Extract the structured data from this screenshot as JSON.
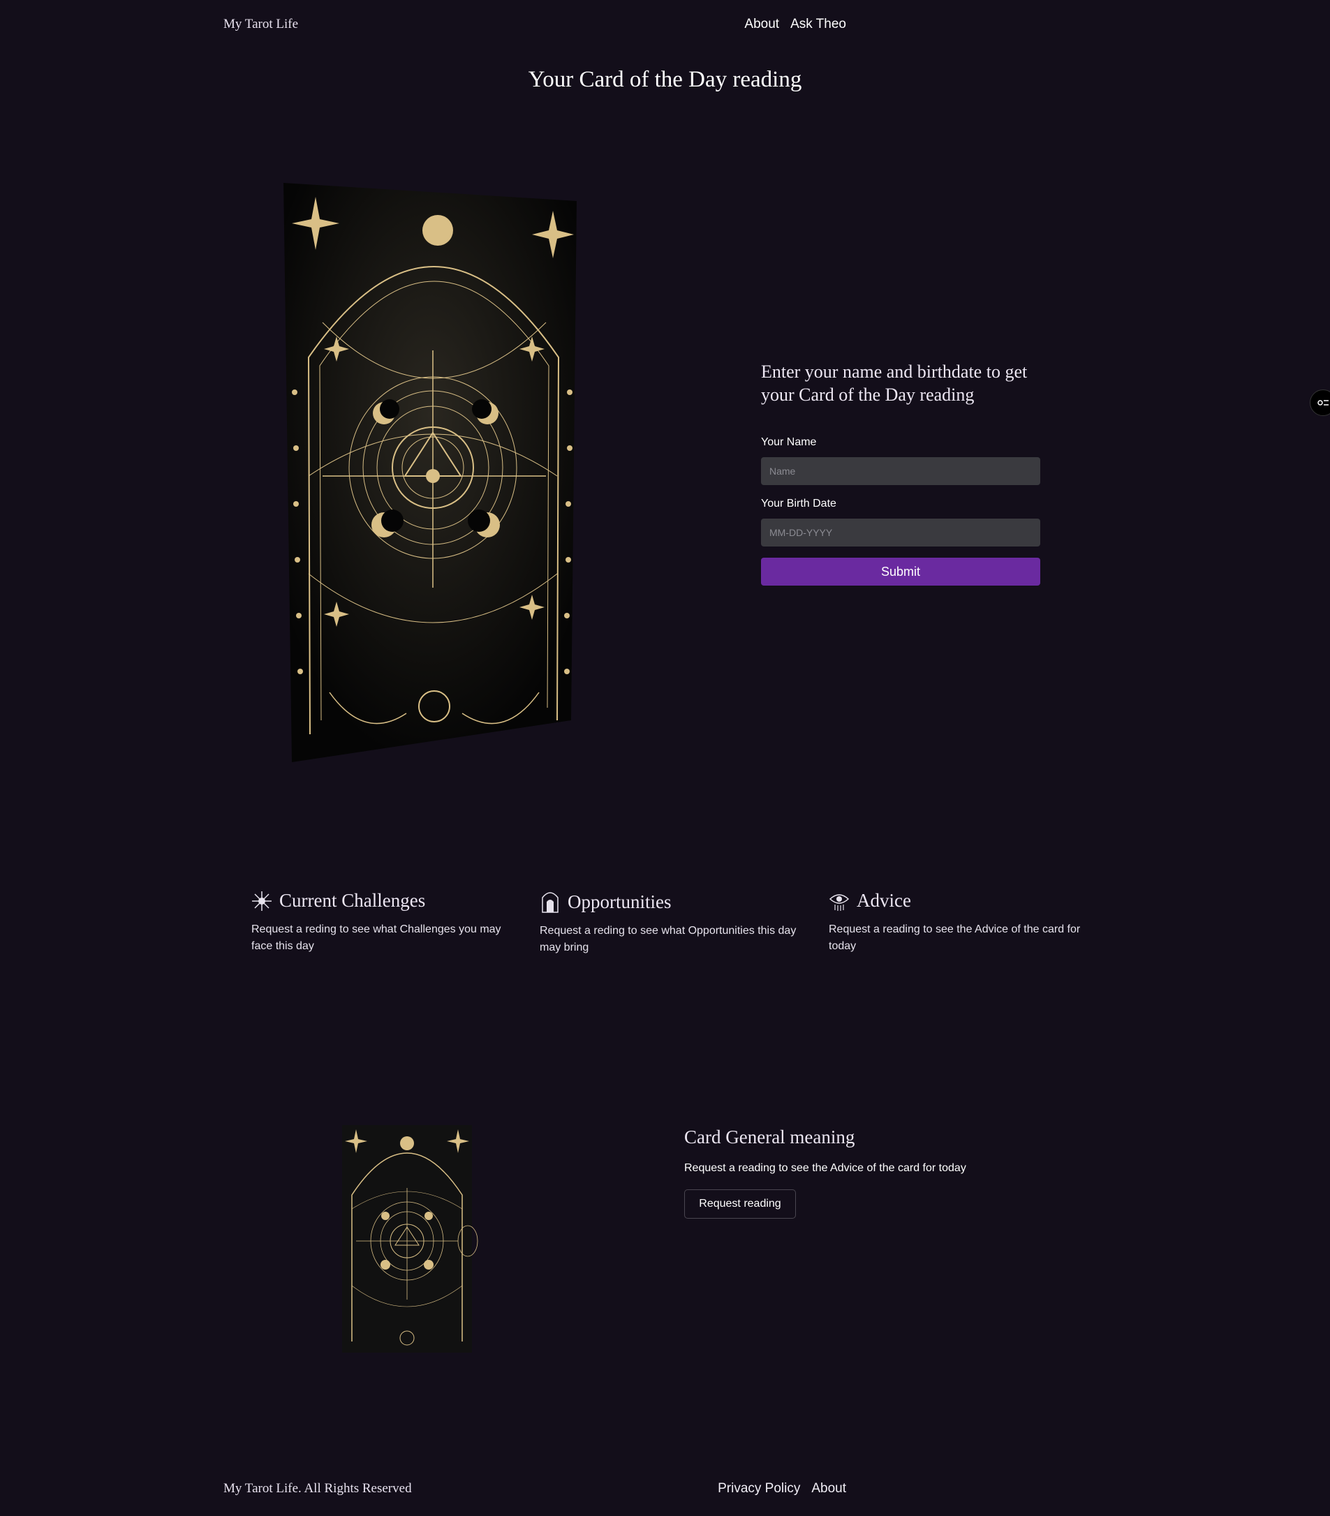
{
  "header": {
    "brand": "My Tarot Life",
    "nav": [
      {
        "label": "About"
      },
      {
        "label": "Ask Theo"
      }
    ]
  },
  "page_title": "Your Card of the Day reading",
  "form": {
    "heading": "Enter your name and birthdate to get your Card of the Day reading",
    "name_label": "Your Name",
    "name_placeholder": "Name",
    "name_value": "",
    "date_label": "Your Birth Date",
    "date_placeholder": "MM-DD-YYYY",
    "date_value": "",
    "submit_label": "Submit"
  },
  "features": [
    {
      "title": "Current Challenges",
      "text": "Request a reding to see what Challenges you may face this day",
      "icon": "starburst-icon"
    },
    {
      "title": "Opportunities",
      "text": "Request a reding to see what Opportunities this day may bring",
      "icon": "doorway-icon"
    },
    {
      "title": "Advice",
      "text": "Request a reading to see the Advice of the card for today",
      "icon": "eye-icon"
    }
  ],
  "meaning": {
    "title": "Card General meaning",
    "text": "Request a reading to see the Advice of the card for today",
    "button_label": "Request reading"
  },
  "footer": {
    "copyright": "My Tarot Life. All Rights Reserved",
    "links": [
      {
        "label": "Privacy Policy"
      },
      {
        "label": "About"
      }
    ]
  },
  "colors": {
    "background": "#130e1a",
    "accent": "#6a2aa0",
    "gold": "#d9bf86",
    "field": "#3a3a3f"
  }
}
